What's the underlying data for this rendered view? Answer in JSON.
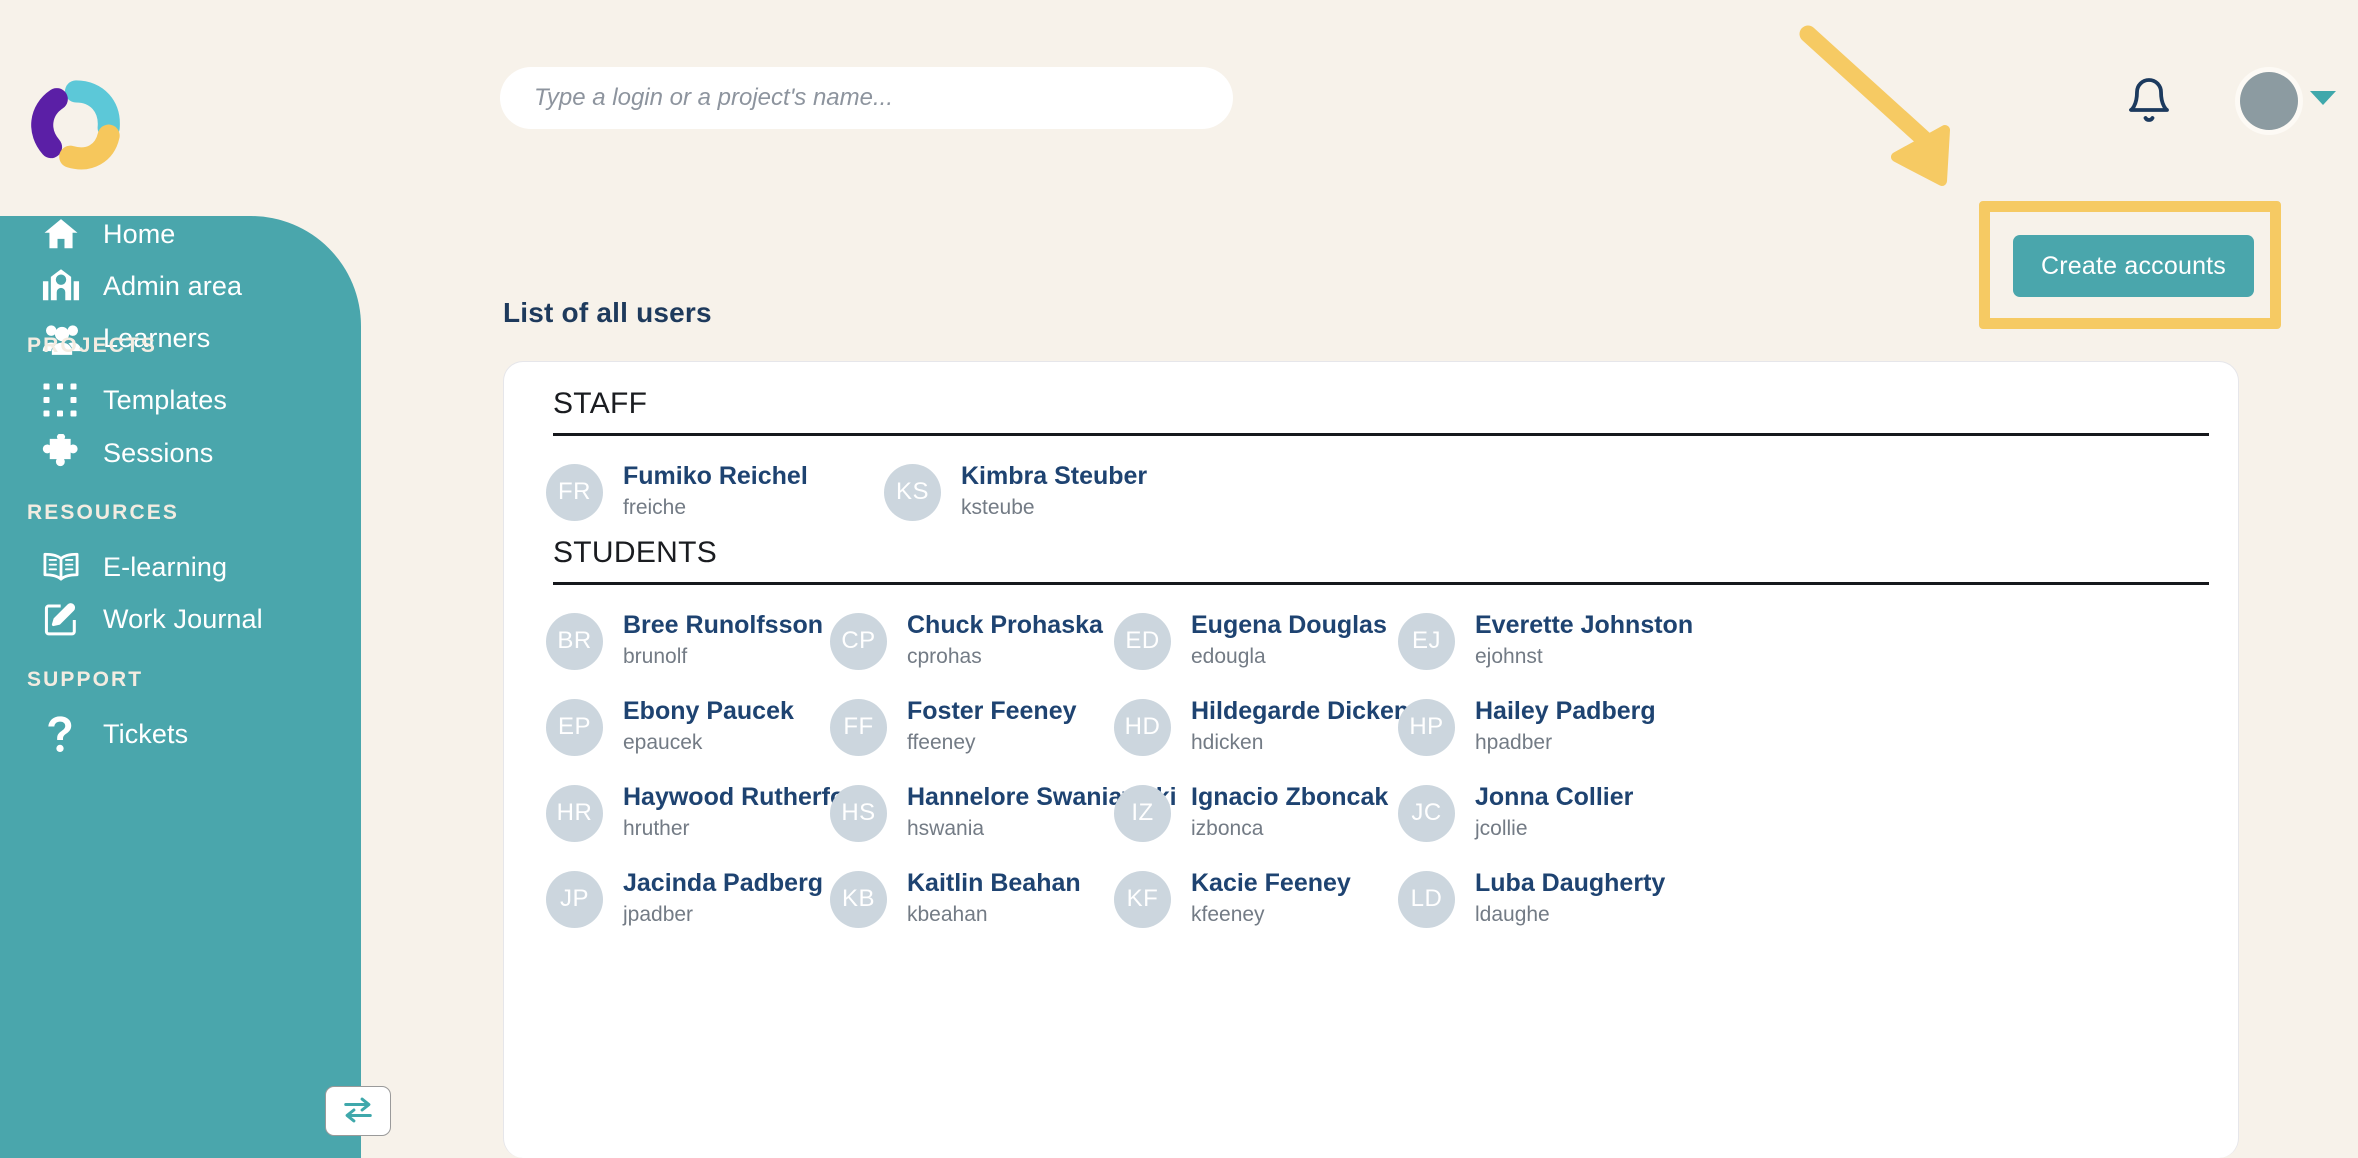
{
  "theme": {
    "bg": "#f7f2ea",
    "sidebar": "#4aa6ac",
    "accent_teal": "#4aa6ac",
    "highlight_yellow": "#f6ca63",
    "name_navy": "#1e4371",
    "title_navy": "#1e3a5c",
    "avatar_gray": "#ccd6de"
  },
  "header": {
    "logo_name": "app-logo",
    "search": {
      "placeholder": "Type a login or a project's name...",
      "value": ""
    },
    "notifications_icon": "bell-icon",
    "avatar_icon": "user-avatar",
    "caret_icon": "chevron-down-icon"
  },
  "annotations": {
    "arrow_icon": "pointer-arrow-icon",
    "highlight_target": "create-accounts-button"
  },
  "sidebar": {
    "toggle_label": "collapse-sidebar",
    "groups": [
      {
        "title": null,
        "items": [
          {
            "label": "Home",
            "icon": "home-icon"
          },
          {
            "label": "Admin area",
            "icon": "school-icon"
          },
          {
            "label": "Learners",
            "icon": "people-icon"
          }
        ]
      },
      {
        "title": "PROJECTS",
        "items": [
          {
            "label": "Templates",
            "icon": "dotted-square-icon"
          },
          {
            "label": "Sessions",
            "icon": "puzzle-piece-icon"
          }
        ]
      },
      {
        "title": "RESOURCES",
        "items": [
          {
            "label": "E-learning",
            "icon": "open-book-icon"
          },
          {
            "label": "Work Journal",
            "icon": "pencil-note-icon"
          }
        ]
      },
      {
        "title": "SUPPORT",
        "items": [
          {
            "label": "Tickets",
            "icon": "question-mark-icon"
          }
        ]
      }
    ]
  },
  "main": {
    "page_title": "List of all users",
    "create_button": "Create accounts",
    "sections": [
      {
        "heading": "STAFF",
        "users": [
          {
            "initials": "FR",
            "name": "Fumiko Reichel",
            "login": "freiche"
          },
          {
            "initials": "KS",
            "name": "Kimbra Steuber",
            "login": "ksteube"
          }
        ]
      },
      {
        "heading": "STUDENTS",
        "users": [
          {
            "initials": "BR",
            "name": "Bree Runolfsson",
            "login": "brunolf"
          },
          {
            "initials": "CP",
            "name": "Chuck Prohaska",
            "login": "cprohas"
          },
          {
            "initials": "ED",
            "name": "Eugena Douglas",
            "login": "edougla"
          },
          {
            "initials": "EJ",
            "name": "Everette Johnston",
            "login": "ejohnst"
          },
          {
            "initials": "EP",
            "name": "Ebony Paucek",
            "login": "epaucek"
          },
          {
            "initials": "FF",
            "name": "Foster Feeney",
            "login": "ffeeney"
          },
          {
            "initials": "HD",
            "name": "Hildegarde Dickens",
            "login": "hdicken"
          },
          {
            "initials": "HP",
            "name": "Hailey Padberg",
            "login": "hpadber"
          },
          {
            "initials": "HR",
            "name": "Haywood Rutherford",
            "login": "hruther"
          },
          {
            "initials": "HS",
            "name": "Hannelore Swaniawski",
            "login": "hswania"
          },
          {
            "initials": "IZ",
            "name": "Ignacio Zboncak",
            "login": "izbonca"
          },
          {
            "initials": "JC",
            "name": "Jonna Collier",
            "login": "jcollie"
          },
          {
            "initials": "JP",
            "name": "Jacinda Padberg",
            "login": "jpadber"
          },
          {
            "initials": "KB",
            "name": "Kaitlin Beahan",
            "login": "kbeahan"
          },
          {
            "initials": "KF",
            "name": "Kacie Feeney",
            "login": "kfeeney"
          },
          {
            "initials": "LD",
            "name": "Luba Daugherty",
            "login": "ldaughe"
          }
        ]
      }
    ]
  }
}
